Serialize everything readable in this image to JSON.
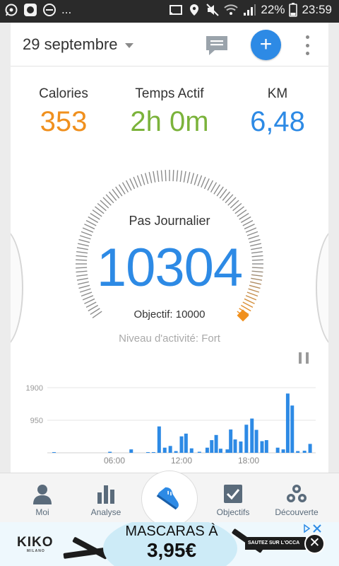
{
  "status_bar": {
    "left_icons": [
      "whatsapp-icon",
      "app-icon",
      "do-not-disturb-icon"
    ],
    "overflow": "...",
    "right_icons": [
      "cast-icon",
      "location-icon",
      "mute-icon",
      "wifi-icon",
      "signal-icon"
    ],
    "battery": "22%",
    "time": "23:59"
  },
  "toolbar": {
    "date": "29 septembre",
    "message_icon": "chat-icon",
    "add_label": "+",
    "more_icon": "more-vertical-icon"
  },
  "stats": [
    {
      "label": "Calories",
      "value": "353",
      "color": "#f0901e"
    },
    {
      "label": "Temps Actif",
      "value": "2h 0m",
      "color": "#7bb33b"
    },
    {
      "label": "KM",
      "value": "6,48",
      "color": "#2d8ae5"
    }
  ],
  "gauge": {
    "title": "Pas Journalier",
    "steps": "10304",
    "goal": "Objectif: 10000",
    "level": "Niveau d'activité: Fort",
    "progress": 1.0,
    "accent": "#2d8ae5",
    "marker_color": "#f0901e"
  },
  "chart_data": {
    "type": "bar",
    "y_ticks": [
      "1900",
      "950"
    ],
    "y_tick_values": [
      1900,
      950
    ],
    "x_ticks": [
      "06:00",
      "12:00",
      "18:00"
    ],
    "x_tick_hours": [
      6,
      12,
      18
    ],
    "ylim": [
      0,
      1900
    ],
    "bar_color": "#2d8ae5",
    "hour_range": [
      0,
      24
    ],
    "bars": [
      {
        "h": 0.6,
        "v": 20
      },
      {
        "h": 5.6,
        "v": 30
      },
      {
        "h": 7.5,
        "v": 100
      },
      {
        "h": 9.0,
        "v": 20
      },
      {
        "h": 9.5,
        "v": 20
      },
      {
        "h": 10.0,
        "v": 770
      },
      {
        "h": 10.5,
        "v": 150
      },
      {
        "h": 11.0,
        "v": 200
      },
      {
        "h": 11.5,
        "v": 50
      },
      {
        "h": 12.0,
        "v": 480
      },
      {
        "h": 12.4,
        "v": 560
      },
      {
        "h": 12.9,
        "v": 130
      },
      {
        "h": 13.6,
        "v": 30
      },
      {
        "h": 14.3,
        "v": 150
      },
      {
        "h": 14.7,
        "v": 370
      },
      {
        "h": 15.1,
        "v": 520
      },
      {
        "h": 15.5,
        "v": 120
      },
      {
        "h": 16.1,
        "v": 100
      },
      {
        "h": 16.4,
        "v": 680
      },
      {
        "h": 16.8,
        "v": 390
      },
      {
        "h": 17.3,
        "v": 330
      },
      {
        "h": 17.8,
        "v": 820
      },
      {
        "h": 18.3,
        "v": 1000
      },
      {
        "h": 18.7,
        "v": 670
      },
      {
        "h": 19.2,
        "v": 340
      },
      {
        "h": 19.6,
        "v": 370
      },
      {
        "h": 20.6,
        "v": 150
      },
      {
        "h": 21.1,
        "v": 100
      },
      {
        "h": 21.5,
        "v": 1730
      },
      {
        "h": 21.9,
        "v": 1380
      },
      {
        "h": 22.4,
        "v": 50
      },
      {
        "h": 23.0,
        "v": 60
      },
      {
        "h": 23.5,
        "v": 260
      }
    ]
  },
  "nav": {
    "items": [
      {
        "label": "Moi",
        "icon": "person-icon"
      },
      {
        "label": "Analyse",
        "icon": "bar-chart-icon"
      },
      {
        "label": "",
        "icon": "shoe-icon"
      },
      {
        "label": "Objectifs",
        "icon": "checkbox-icon"
      },
      {
        "label": "Découverte",
        "icon": "discover-icon"
      }
    ]
  },
  "ad": {
    "brand": "KIKO",
    "brand_sub": "MILANO",
    "line1": "MASCARAS À",
    "line2": "3,95€",
    "cta": "SAUTEZ SUR L'OCCA",
    "close": "✕"
  }
}
